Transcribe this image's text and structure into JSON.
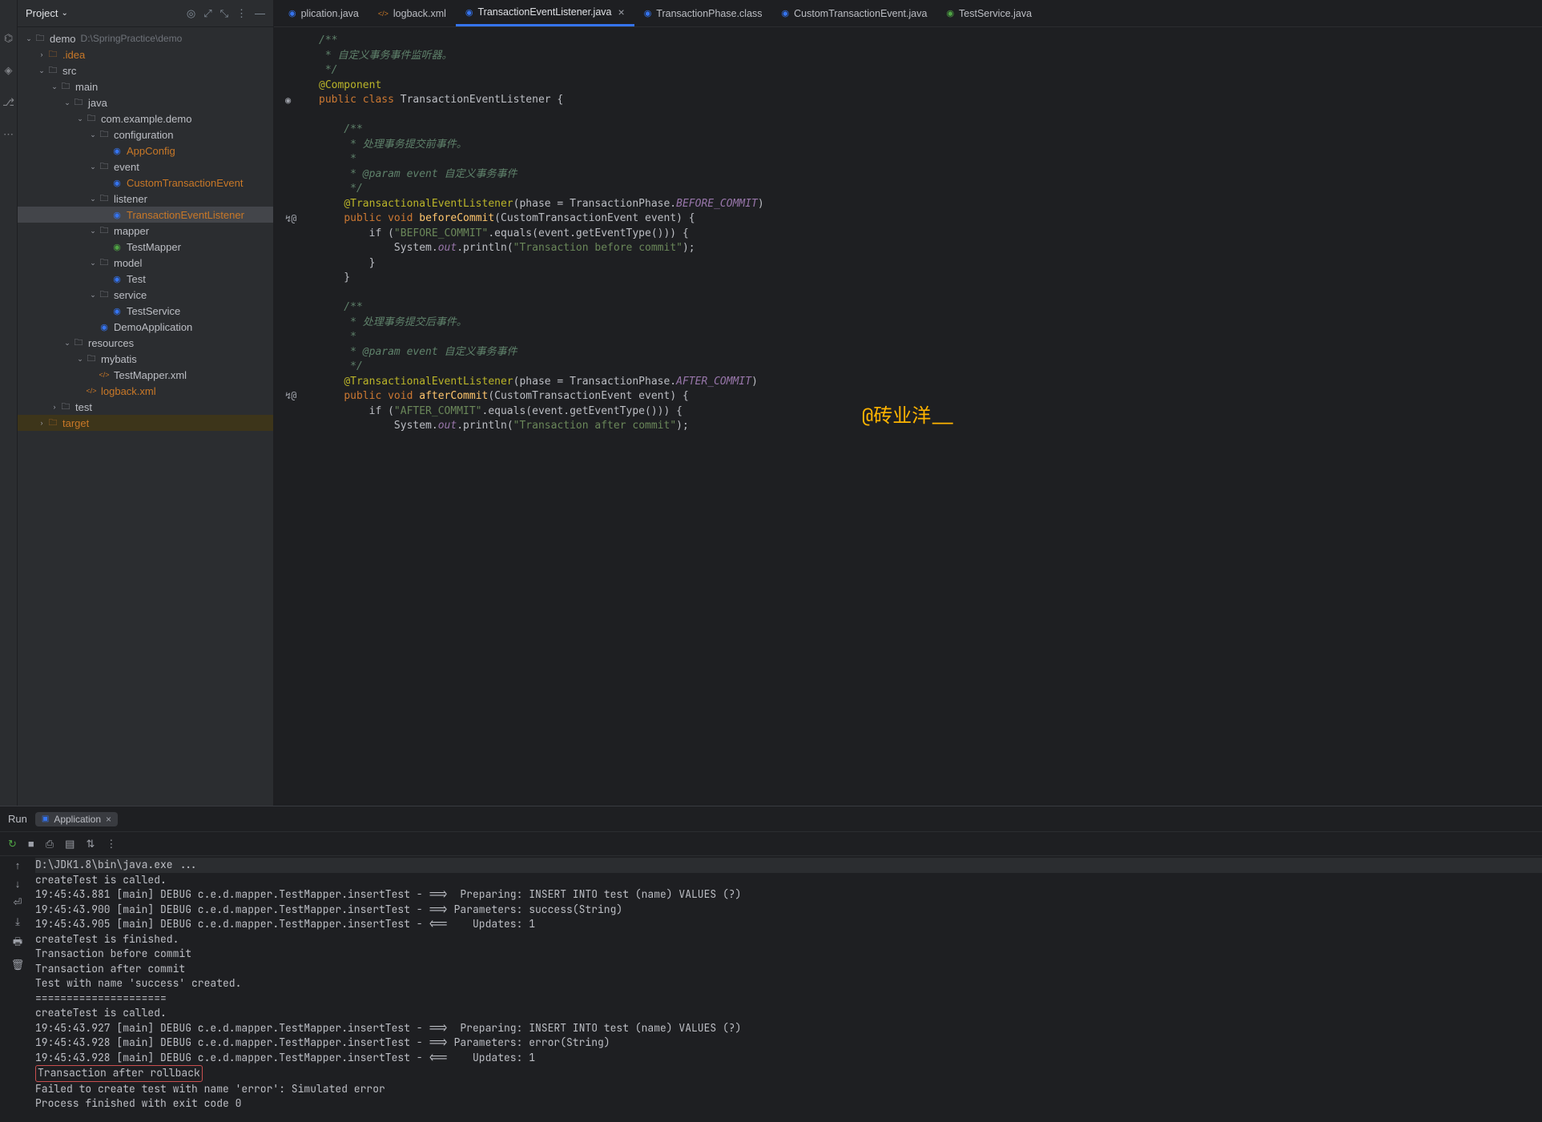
{
  "sidebar": {
    "title": "Project",
    "root": {
      "name": "demo",
      "path": "D:\\SpringPractice\\demo"
    },
    "tree": [
      {
        "d": 0,
        "c": "open",
        "i": "folder",
        "label": "demo",
        "path": "D:\\SpringPractice\\demo"
      },
      {
        "d": 1,
        "c": "closed",
        "i": "folder-x",
        "label": ".idea",
        "cls": "orange"
      },
      {
        "d": 1,
        "c": "open",
        "i": "folder",
        "label": "src"
      },
      {
        "d": 2,
        "c": "open",
        "i": "folder",
        "label": "main"
      },
      {
        "d": 3,
        "c": "open",
        "i": "folder",
        "label": "java"
      },
      {
        "d": 4,
        "c": "open",
        "i": "folder",
        "label": "com.example.demo"
      },
      {
        "d": 5,
        "c": "open",
        "i": "folder",
        "label": "configuration"
      },
      {
        "d": 6,
        "c": "none",
        "i": "java",
        "label": "AppConfig",
        "cls": "orange"
      },
      {
        "d": 5,
        "c": "open",
        "i": "folder",
        "label": "event"
      },
      {
        "d": 6,
        "c": "none",
        "i": "java",
        "label": "CustomTransactionEvent",
        "cls": "orange"
      },
      {
        "d": 5,
        "c": "open",
        "i": "folder",
        "label": "listener"
      },
      {
        "d": 6,
        "c": "none",
        "i": "java",
        "label": "TransactionEventListener",
        "cls": "orange",
        "sel": true
      },
      {
        "d": 5,
        "c": "open",
        "i": "folder",
        "label": "mapper"
      },
      {
        "d": 6,
        "c": "none",
        "i": "iface",
        "label": "TestMapper"
      },
      {
        "d": 5,
        "c": "open",
        "i": "folder",
        "label": "model"
      },
      {
        "d": 6,
        "c": "none",
        "i": "java",
        "label": "Test"
      },
      {
        "d": 5,
        "c": "open",
        "i": "folder",
        "label": "service"
      },
      {
        "d": 6,
        "c": "none",
        "i": "java",
        "label": "TestService"
      },
      {
        "d": 5,
        "c": "none",
        "i": "java",
        "label": "DemoApplication"
      },
      {
        "d": 3,
        "c": "open",
        "i": "folder",
        "label": "resources"
      },
      {
        "d": 4,
        "c": "open",
        "i": "folder",
        "label": "mybatis"
      },
      {
        "d": 5,
        "c": "none",
        "i": "xml",
        "label": "TestMapper.xml"
      },
      {
        "d": 4,
        "c": "none",
        "i": "xml",
        "label": "logback.xml",
        "cls": "orange"
      },
      {
        "d": 2,
        "c": "closed",
        "i": "folder",
        "label": "test"
      },
      {
        "d": 1,
        "c": "closed",
        "i": "folder-x",
        "label": "target",
        "cls": "orange",
        "hl": true
      }
    ]
  },
  "tabs": [
    {
      "icon": "j",
      "label": "plication.java"
    },
    {
      "icon": "x",
      "label": "logback.xml"
    },
    {
      "icon": "j",
      "label": "TransactionEventListener.java",
      "active": true,
      "close": true
    },
    {
      "icon": "j",
      "label": "TransactionPhase.class"
    },
    {
      "icon": "j",
      "label": "CustomTransactionEvent.java"
    },
    {
      "icon": "c",
      "label": "TestService.java"
    }
  ],
  "code": {
    "doc1_l1": "/**",
    "doc1_l2": " * 自定义事务事件监听器。",
    "doc1_l3": " */",
    "ann_comp": "@Component",
    "kw_public": "public",
    "kw_class": "class",
    "cls_name": "TransactionEventListener",
    "brace_o": " {",
    "doc2_l1": "    /**",
    "doc2_l2": "     * 处理事务提交前事件。",
    "doc2_l3": "     *",
    "doc2_l4": "     * @param event ",
    "doc2_l4b": "自定义事务事件",
    "doc2_l5": "     */",
    "ann_tel1": "@TransactionalEventListener",
    "tel1_rest": "(phase = TransactionPhase.",
    "tel1_const": "BEFORE_COMMIT",
    "tel1_end": ")",
    "kw_void": "void",
    "m_before": "beforeCommit",
    "sig1": "(CustomTransactionEvent event) {",
    "if1a": "        if (",
    "if1s": "\"BEFORE_COMMIT\"",
    "if1b": ".equals(event.getEventType())) {",
    "sys": "            System.",
    "out": "out",
    "println": ".println(",
    "str1": "\"Transaction before commit\"",
    "end_paren": ");",
    "cb3": "        }",
    "cb2": "    }",
    "doc3_l1": "    /**",
    "doc3_l2": "     * 处理事务提交后事件。",
    "doc3_l3": "     *",
    "doc3_l4": "     * @param event ",
    "doc3_l4b": "自定义事务事件",
    "doc3_l5": "     */",
    "tel2_const": "AFTER_COMMIT",
    "m_after": "afterCommit",
    "if2s": "\"AFTER_COMMIT\"",
    "str2": "\"Transaction after commit\""
  },
  "watermark": "@砖业洋__",
  "bottom": {
    "run": "Run",
    "config": "Application"
  },
  "console": [
    {
      "t": "D:\\JDK1.8\\bin\\java.exe ...",
      "muted": true
    },
    {
      "t": "createTest is called."
    },
    {
      "t": "19:45:43.881 [main] DEBUG c.e.d.mapper.TestMapper.insertTest - ==>  Preparing: INSERT INTO test (name) VALUES (?)"
    },
    {
      "t": "19:45:43.900 [main] DEBUG c.e.d.mapper.TestMapper.insertTest - ==> Parameters: success(String)"
    },
    {
      "t": "19:45:43.905 [main] DEBUG c.e.d.mapper.TestMapper.insertTest - <==    Updates: 1"
    },
    {
      "t": "createTest is finished."
    },
    {
      "t": "Transaction before commit"
    },
    {
      "t": "Transaction after commit"
    },
    {
      "t": "Test with name 'success' created."
    },
    {
      "t": "====================="
    },
    {
      "t": "createTest is called."
    },
    {
      "t": "19:45:43.927 [main] DEBUG c.e.d.mapper.TestMapper.insertTest - ==>  Preparing: INSERT INTO test (name) VALUES (?)"
    },
    {
      "t": "19:45:43.928 [main] DEBUG c.e.d.mapper.TestMapper.insertTest - ==> Parameters: error(String)"
    },
    {
      "t": "19:45:43.928 [main] DEBUG c.e.d.mapper.TestMapper.insertTest - <==    Updates: 1"
    },
    {
      "t": "Transaction after rollback",
      "hl": true
    },
    {
      "t": "Failed to create test with name 'error': Simulated error"
    },
    {
      "t": ""
    },
    {
      "t": "Process finished with exit code 0"
    }
  ]
}
